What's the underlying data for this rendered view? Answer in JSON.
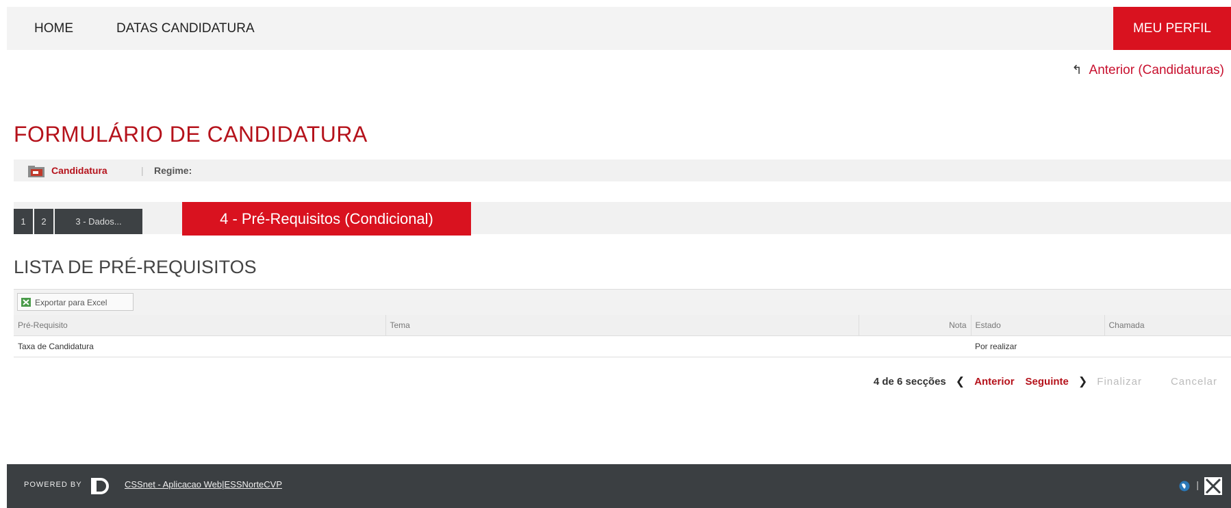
{
  "nav": {
    "home": "HOME",
    "datas": "DATAS CANDIDATURA",
    "perfil": "MEU PERFIL"
  },
  "back_link": "Anterior (Candidaturas)",
  "page_title": "FORMULÁRIO DE CANDIDATURA",
  "subbar": {
    "candidatura": "Candidatura",
    "separator": "|",
    "regime": "Regime:"
  },
  "steps": [
    {
      "label": "1"
    },
    {
      "label": "2"
    },
    {
      "label": "3 - Dados..."
    },
    {
      "label": "4 - Pré-Requisitos (Condicional)"
    }
  ],
  "section_title": "LISTA DE PRÉ-REQUISITOS",
  "grid": {
    "export_label": "Exportar para Excel",
    "headers": [
      "Pré-Requisito",
      "Tema",
      "Nota",
      "Estado",
      "Chamada"
    ],
    "rows": [
      [
        "Taxa de Candidatura",
        "",
        "",
        "Por realizar",
        ""
      ]
    ]
  },
  "pager": {
    "count": "4 de 6 secções",
    "prev": "Anterior",
    "next": "Seguinte",
    "finish": "Finalizar",
    "cancel": "Cancelar"
  },
  "footer": {
    "powered_by": "Powered by",
    "app_link": "CSSnet - Aplicacao Web|ESSNorteCVP",
    "pipe": "|"
  },
  "colors": {
    "accent": "#d9121f",
    "title": "#b5121b",
    "dark": "#3b3f42"
  }
}
